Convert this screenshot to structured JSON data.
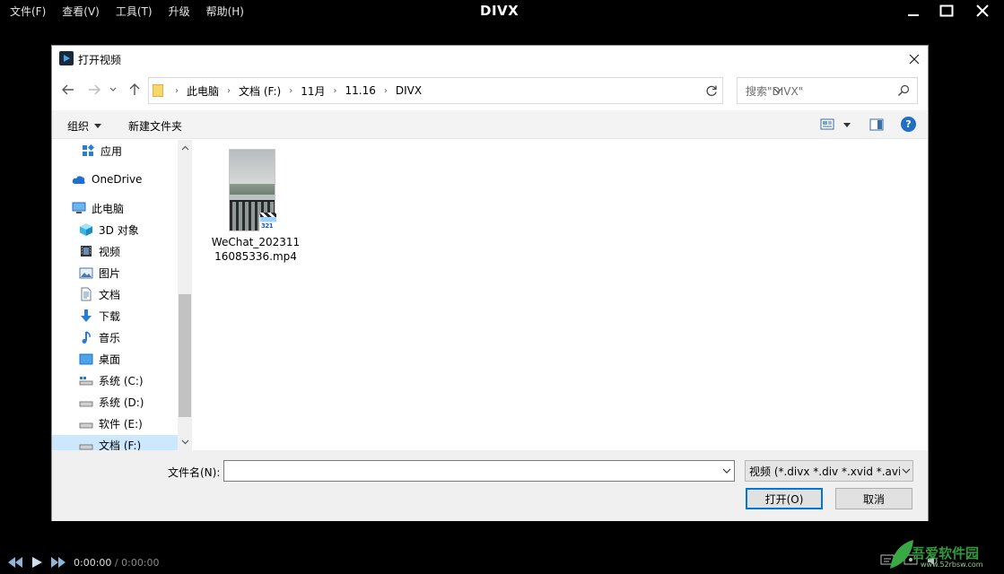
{
  "player": {
    "menu": [
      "文件(F)",
      "查看(V)",
      "工具(T)",
      "升级",
      "帮助(H)"
    ],
    "logo": "DIVX",
    "time_current": "0:00:00",
    "time_sep": " / ",
    "time_total": "0:00:00",
    "watermark_text": "吾爱软件园",
    "watermark_url": "www.52rbsw.com"
  },
  "dialog": {
    "title": "打开视频",
    "breadcrumb": [
      "此电脑",
      "文档 (F:)",
      "11月",
      "11.16",
      "DIVX"
    ],
    "search_placeholder": "搜索\"DIVX\"",
    "toolbar": {
      "organize": "组织",
      "new_folder": "新建文件夹"
    },
    "tree": [
      {
        "label": "应用",
        "icon": "apps-icon"
      },
      {
        "label": "OneDrive",
        "icon": "cloud-icon"
      },
      {
        "label": "此电脑",
        "icon": "computer-icon"
      },
      {
        "label": "3D 对象",
        "icon": "cube-icon"
      },
      {
        "label": "视频",
        "icon": "video-icon"
      },
      {
        "label": "图片",
        "icon": "picture-icon"
      },
      {
        "label": "文档",
        "icon": "document-icon"
      },
      {
        "label": "下载",
        "icon": "download-icon"
      },
      {
        "label": "音乐",
        "icon": "music-icon"
      },
      {
        "label": "桌面",
        "icon": "desktop-icon"
      },
      {
        "label": "系统 (C:)",
        "icon": "drive-icon"
      },
      {
        "label": "系统 (D:)",
        "icon": "drive-icon"
      },
      {
        "label": "软件 (E:)",
        "icon": "drive-icon"
      },
      {
        "label": "文档 (F:)",
        "icon": "drive-icon"
      }
    ],
    "files": [
      {
        "name": "WeChat_20231116085336.mp4",
        "icon": "video-file-icon"
      }
    ],
    "filename_label": "文件名(N):",
    "filename_value": "",
    "filter": "视频 (*.divx *.div *.xvid *.avi *",
    "open_button": "打开(O)",
    "cancel_button": "取消",
    "colors": {
      "accent": "#0078d7",
      "selected_bg": "#cce8ff",
      "help": "#1f6fc5"
    }
  }
}
